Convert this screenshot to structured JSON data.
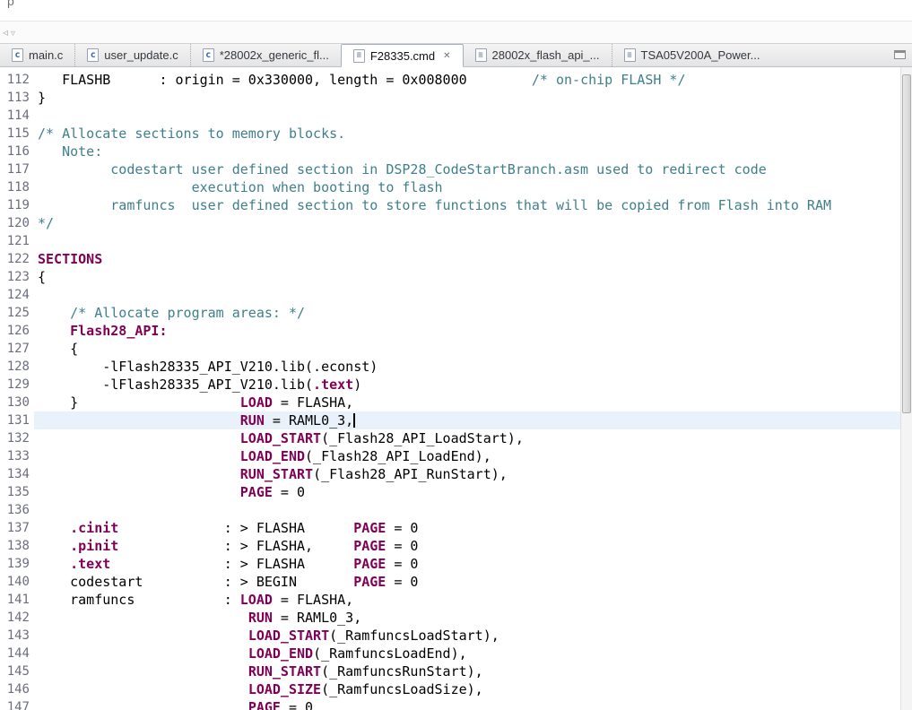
{
  "app": {
    "clipped_top_text": "p",
    "nav": {
      "back_icon_glyph": "◃",
      "dropdown_icon_glyph": "▿"
    },
    "view_controls": {
      "minimize_glyph": "▭"
    }
  },
  "tabs": [
    {
      "label": "main.c",
      "icon_name": "c-source-file-icon",
      "icon_class": "c",
      "icon_letter": "c",
      "active": false
    },
    {
      "label": "user_update.c",
      "icon_name": "c-source-file-icon",
      "icon_class": "c",
      "icon_letter": "c",
      "active": false
    },
    {
      "label": "*28002x_generic_fl...",
      "icon_name": "c-source-file-icon",
      "icon_class": "c",
      "icon_letter": "c",
      "active": false
    },
    {
      "label": "F28335.cmd",
      "icon_name": "cmd-file-icon",
      "icon_class": "doc",
      "icon_letter": "≡",
      "active": true,
      "close_glyph": "✕"
    },
    {
      "label": "28002x_flash_api_...",
      "icon_name": "cmd-file-icon",
      "icon_class": "doc",
      "icon_letter": "≡",
      "active": false
    },
    {
      "label": "TSA05V200A_Power...",
      "icon_name": "document-file-icon",
      "icon_class": "doc",
      "icon_letter": "≡",
      "active": false
    }
  ],
  "editor": {
    "file": "F28335.cmd",
    "language": "linker-command-file",
    "current_line": 131,
    "colors": {
      "keyword": "#7F0055",
      "comment": "#3F7F8C",
      "plain": "#000000",
      "current_line_bg": "#E9F2FB"
    },
    "lines": [
      {
        "num": 112,
        "seg": [
          {
            "c": "p",
            "t": "   FLASHB      : origin = 0x330000, length = 0x008000        "
          },
          {
            "c": "m",
            "t": "/* on-chip FLASH */"
          }
        ]
      },
      {
        "num": 113,
        "seg": [
          {
            "c": "p",
            "t": "}"
          }
        ]
      },
      {
        "num": 114,
        "seg": []
      },
      {
        "num": 115,
        "seg": [
          {
            "c": "m",
            "t": "/* Allocate sections to memory blocks."
          }
        ]
      },
      {
        "num": 116,
        "seg": [
          {
            "c": "m",
            "t": "   Note:"
          }
        ]
      },
      {
        "num": 117,
        "seg": [
          {
            "c": "m",
            "t": "         codestart user defined section in DSP28_CodeStartBranch.asm used to redirect code"
          }
        ]
      },
      {
        "num": 118,
        "seg": [
          {
            "c": "m",
            "t": "                   execution when booting to flash"
          }
        ]
      },
      {
        "num": 119,
        "seg": [
          {
            "c": "m",
            "t": "         ramfuncs  user defined section to store functions that will be copied from Flash into RAM"
          }
        ]
      },
      {
        "num": 120,
        "seg": [
          {
            "c": "m",
            "t": "*/"
          }
        ]
      },
      {
        "num": 121,
        "seg": []
      },
      {
        "num": 122,
        "seg": [
          {
            "c": "k",
            "t": "SECTIONS"
          }
        ]
      },
      {
        "num": 123,
        "seg": [
          {
            "c": "p",
            "t": "{"
          }
        ]
      },
      {
        "num": 124,
        "seg": []
      },
      {
        "num": 125,
        "seg": [
          {
            "c": "m",
            "t": "    /* Allocate program areas: */"
          }
        ]
      },
      {
        "num": 126,
        "seg": [
          {
            "c": "p",
            "t": "    "
          },
          {
            "c": "k",
            "t": "Flash28_API:"
          }
        ]
      },
      {
        "num": 127,
        "seg": [
          {
            "c": "p",
            "t": "    {"
          }
        ]
      },
      {
        "num": 128,
        "seg": [
          {
            "c": "p",
            "t": "        -lFlash28335_API_V210.lib(.econst)"
          }
        ]
      },
      {
        "num": 129,
        "seg": [
          {
            "c": "p",
            "t": "        -lFlash28335_API_V210.lib("
          },
          {
            "c": "k",
            "t": ".text"
          },
          {
            "c": "p",
            "t": ")"
          }
        ]
      },
      {
        "num": 130,
        "seg": [
          {
            "c": "p",
            "t": "    }                    "
          },
          {
            "c": "k",
            "t": "LOAD"
          },
          {
            "c": "p",
            "t": " = FLASHA,"
          }
        ]
      },
      {
        "num": 131,
        "cursor": true,
        "seg": [
          {
            "c": "p",
            "t": "                         "
          },
          {
            "c": "k",
            "t": "RUN"
          },
          {
            "c": "p",
            "t": " = RAML0_3,"
          }
        ]
      },
      {
        "num": 132,
        "seg": [
          {
            "c": "p",
            "t": "                         "
          },
          {
            "c": "k",
            "t": "LOAD_START"
          },
          {
            "c": "p",
            "t": "(_Flash28_API_LoadStart),"
          }
        ]
      },
      {
        "num": 133,
        "seg": [
          {
            "c": "p",
            "t": "                         "
          },
          {
            "c": "k",
            "t": "LOAD_END"
          },
          {
            "c": "p",
            "t": "(_Flash28_API_LoadEnd),"
          }
        ]
      },
      {
        "num": 134,
        "seg": [
          {
            "c": "p",
            "t": "                         "
          },
          {
            "c": "k",
            "t": "RUN_START"
          },
          {
            "c": "p",
            "t": "(_Flash28_API_RunStart),"
          }
        ]
      },
      {
        "num": 135,
        "seg": [
          {
            "c": "p",
            "t": "                         "
          },
          {
            "c": "k",
            "t": "PAGE"
          },
          {
            "c": "p",
            "t": " = 0"
          }
        ]
      },
      {
        "num": 136,
        "seg": []
      },
      {
        "num": 137,
        "seg": [
          {
            "c": "p",
            "t": "    "
          },
          {
            "c": "k",
            "t": ".cinit"
          },
          {
            "c": "p",
            "t": "             : > FLASHA      "
          },
          {
            "c": "k",
            "t": "PAGE"
          },
          {
            "c": "p",
            "t": " = 0"
          }
        ]
      },
      {
        "num": 138,
        "seg": [
          {
            "c": "p",
            "t": "    "
          },
          {
            "c": "k",
            "t": ".pinit"
          },
          {
            "c": "p",
            "t": "             : > FLASHA,     "
          },
          {
            "c": "k",
            "t": "PAGE"
          },
          {
            "c": "p",
            "t": " = 0"
          }
        ]
      },
      {
        "num": 139,
        "seg": [
          {
            "c": "p",
            "t": "    "
          },
          {
            "c": "k",
            "t": ".text"
          },
          {
            "c": "p",
            "t": "              : > FLASHA      "
          },
          {
            "c": "k",
            "t": "PAGE"
          },
          {
            "c": "p",
            "t": " = 0"
          }
        ]
      },
      {
        "num": 140,
        "seg": [
          {
            "c": "p",
            "t": "    codestart          : > BEGIN       "
          },
          {
            "c": "k",
            "t": "PAGE"
          },
          {
            "c": "p",
            "t": " = 0"
          }
        ]
      },
      {
        "num": 141,
        "seg": [
          {
            "c": "p",
            "t": "    ramfuncs           : "
          },
          {
            "c": "k",
            "t": "LOAD"
          },
          {
            "c": "p",
            "t": " = FLASHA,"
          }
        ]
      },
      {
        "num": 142,
        "seg": [
          {
            "c": "p",
            "t": "                          "
          },
          {
            "c": "k",
            "t": "RUN"
          },
          {
            "c": "p",
            "t": " = RAML0_3,"
          }
        ]
      },
      {
        "num": 143,
        "seg": [
          {
            "c": "p",
            "t": "                          "
          },
          {
            "c": "k",
            "t": "LOAD_START"
          },
          {
            "c": "p",
            "t": "(_RamfuncsLoadStart),"
          }
        ]
      },
      {
        "num": 144,
        "seg": [
          {
            "c": "p",
            "t": "                          "
          },
          {
            "c": "k",
            "t": "LOAD_END"
          },
          {
            "c": "p",
            "t": "(_RamfuncsLoadEnd),"
          }
        ]
      },
      {
        "num": 145,
        "seg": [
          {
            "c": "p",
            "t": "                          "
          },
          {
            "c": "k",
            "t": "RUN_START"
          },
          {
            "c": "p",
            "t": "(_RamfuncsRunStart),"
          }
        ]
      },
      {
        "num": 146,
        "seg": [
          {
            "c": "p",
            "t": "                          "
          },
          {
            "c": "k",
            "t": "LOAD_SIZE"
          },
          {
            "c": "p",
            "t": "(_RamfuncsLoadSize),"
          }
        ]
      },
      {
        "num": 147,
        "seg": [
          {
            "c": "p",
            "t": "                          "
          },
          {
            "c": "k",
            "t": "PAGE"
          },
          {
            "c": "p",
            "t": " = 0"
          }
        ]
      }
    ]
  }
}
